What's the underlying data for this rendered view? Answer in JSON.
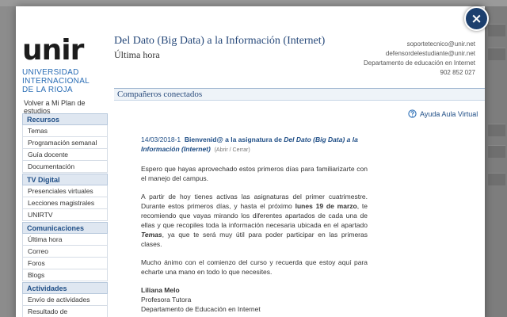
{
  "close_label": "×",
  "logo": {
    "word": "unir",
    "lines": [
      "UNIVERSIDAD",
      "INTERNACIONAL",
      "DE LA RIOJA"
    ]
  },
  "back_link": "Volver a Mi Plan de estudios",
  "menu": [
    {
      "type": "head",
      "label": "Recursos"
    },
    {
      "type": "item",
      "label": "Temas"
    },
    {
      "type": "item",
      "label": "Programación semanal"
    },
    {
      "type": "item",
      "label": "Guía docente"
    },
    {
      "type": "item",
      "label": "Documentación"
    },
    {
      "type": "head",
      "label": "TV Digital"
    },
    {
      "type": "item",
      "label": "Presenciales virtuales"
    },
    {
      "type": "item",
      "label": "Lecciones magistrales"
    },
    {
      "type": "item",
      "label": "UNIRTV"
    },
    {
      "type": "head",
      "label": "Comunicaciones"
    },
    {
      "type": "item",
      "label": "Última hora"
    },
    {
      "type": "item",
      "label": "Correo"
    },
    {
      "type": "item",
      "label": "Foros"
    },
    {
      "type": "item",
      "label": "Blogs"
    },
    {
      "type": "head",
      "label": "Actividades"
    },
    {
      "type": "item",
      "label": "Envío de actividades"
    },
    {
      "type": "item",
      "label": "Resultado de actividades"
    }
  ],
  "header": {
    "title": "Del Dato (Big Data) a la Información (Internet)",
    "subtitle": "Última hora",
    "contact": [
      "soportetecnico@unir.net",
      "defensordelestudiante@unir.net",
      "Departamento de educación en Internet",
      "902 852 027"
    ]
  },
  "connected": "Compañeros conectados",
  "help_link": "Ayuda Aula Virtual",
  "message": {
    "date": "14/03/2018-1",
    "intro": "Bienvenid@ a la asignatura de",
    "course": "Del Dato (Big Data) a la Información (Internet)",
    "toggle": "(Abrir / Cerrar)",
    "p1": "Espero que hayas aprovechado estos primeros días para familiarizarte con el manejo del campus.",
    "p2a": "A partir de hoy tienes activas las asignaturas del primer cuatrimestre. Durante estos primeros días, y hasta el próximo",
    "p2b": "lunes 19 de marzo",
    "p2c": ", te recomiendo que vayas mirando los diferentes apartados de cada una de ellas y que recopiles toda la información necesaria ubicada en el apartado",
    "p2d": "Temas",
    "p2e": ", ya que te será muy útil para poder participar en las primeras clases.",
    "p3": "Mucho ánimo con el comienzo del curso y recuerda que estoy aquí para echarte una mano en todo lo que necesites.",
    "sign_name": "Liliana Melo",
    "sign_role": "Profesora Tutora",
    "sign_dept": "Departamento de Educación en Internet"
  }
}
